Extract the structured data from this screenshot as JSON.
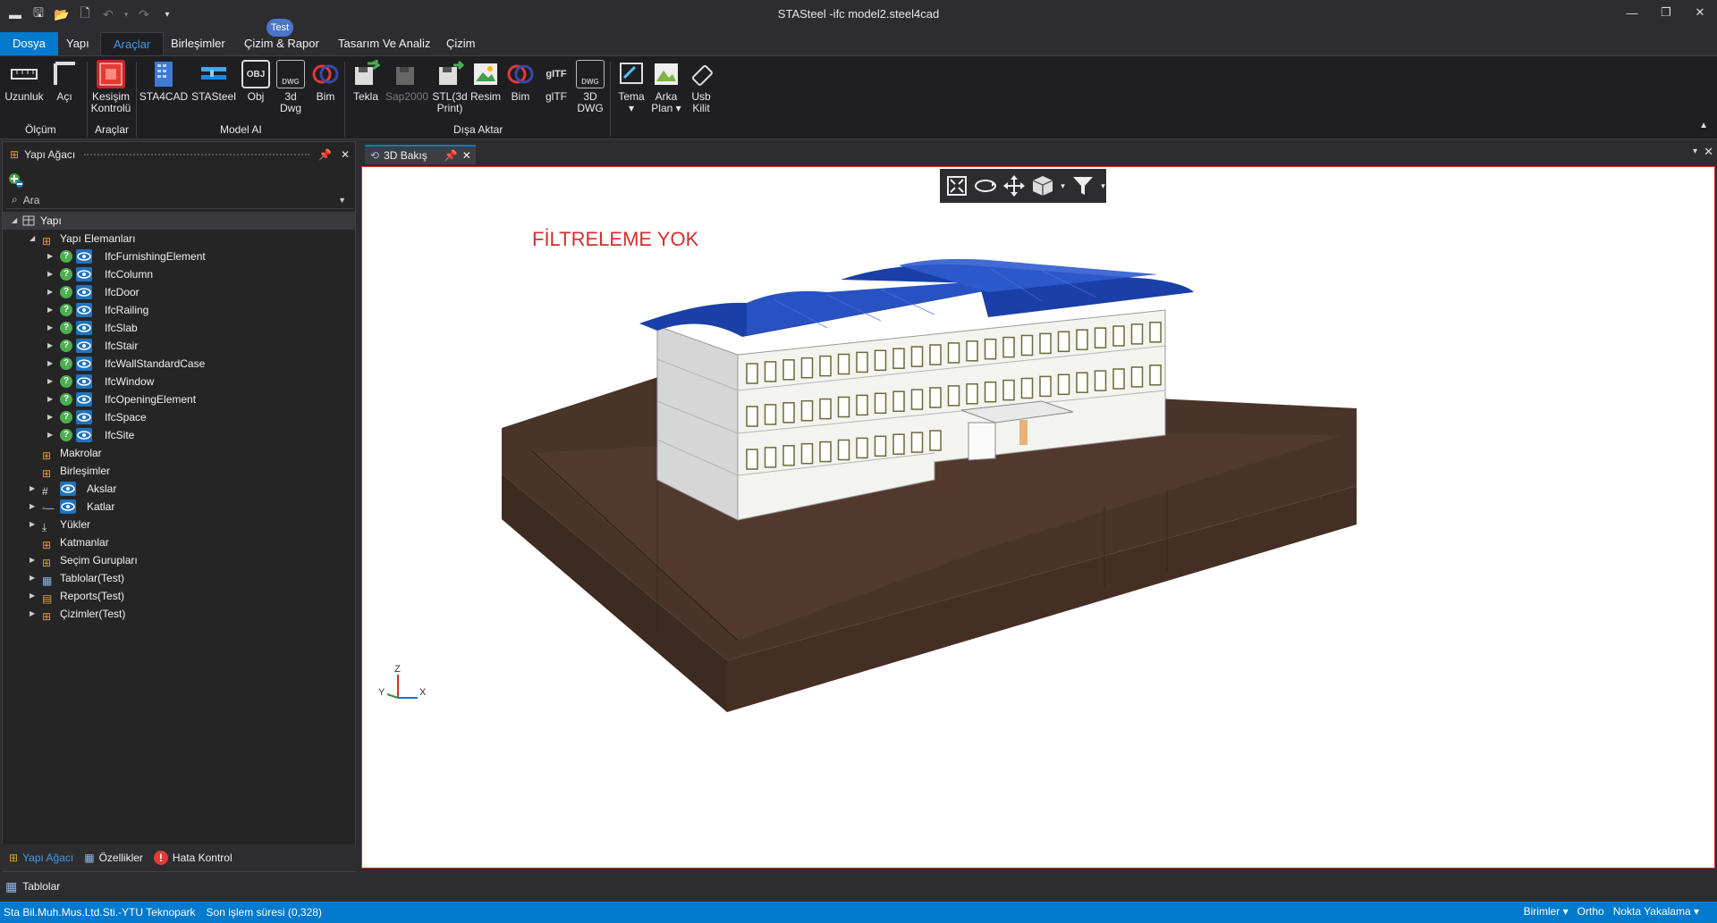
{
  "window": {
    "title": "STASteel -ifc model2.steel4cad"
  },
  "ribbon_tabs": [
    {
      "label": "Dosya"
    },
    {
      "label": "Yapı"
    },
    {
      "label": "Araçlar"
    },
    {
      "label": "Birleşimler"
    },
    {
      "label": "Çizim & Rapor"
    },
    {
      "label": "Tasarım Ve Analiz"
    },
    {
      "label": "Çizim"
    }
  ],
  "test_badge": "Test",
  "ribbon": {
    "buttons": {
      "uzunluk": "Uzunluk",
      "aci": "Açı",
      "kesisim": "Kesişim\nKontrolü",
      "sta4cad": "STA4CAD",
      "stasteel": "STASteel",
      "obj": "Obj",
      "dwg3d": "3d\nDwg",
      "bim1": "Bim",
      "tekla": "Tekla",
      "sap2000": "Sap2000",
      "stl": "STL(3d\nPrint)",
      "resim": "Resim",
      "bim2": "Bim",
      "gltf": "glTF",
      "dwg3dCaps": "3D\nDWG",
      "tema": "Tema",
      "arkaplan": "Arka\nPlan",
      "usb": "Usb\nKilit"
    },
    "icon_texts": {
      "obj": "OBJ",
      "dwg": "DWG",
      "gltf": "gITF"
    },
    "groups": {
      "olcum": "Ölçüm",
      "araclar": "Araçlar",
      "modelai": "Model AI",
      "disa": "Dışa Aktar"
    }
  },
  "left_panel": {
    "title": "Yapı Ağacı",
    "search_placeholder": "Ara",
    "tree": {
      "root": "Yapı",
      "elements": "Yapı Elemanları",
      "ifc": [
        "IfcFurnishingElement",
        "IfcColumn",
        "IfcDoor",
        "IfcRailing",
        "IfcSlab",
        "IfcStair",
        "IfcWallStandardCase",
        "IfcWindow",
        "IfcOpeningElement",
        "IfcSpace",
        "IfcSite"
      ],
      "makrolar": "Makrolar",
      "birlesimler": "Birleşimler",
      "akslar": "Akslar",
      "katlar": "Katlar",
      "yukler": "Yükler",
      "katmanlar": "Katmanlar",
      "secim": "Seçim Gurupları",
      "tablolar": "Tablolar(Test)",
      "reports": "Reports(Test)",
      "cizimler": "Çizimler(Test)"
    },
    "bottom_tabs": {
      "tree": "Yapı Ağacı",
      "props": "Özellikler",
      "errors": "Hata Kontrol"
    }
  },
  "document": {
    "tab": "3D Bakış",
    "label": "FİLTRELEME YOK",
    "axes": {
      "z": "Z",
      "y": "Y",
      "x": "X"
    }
  },
  "bottom_panel": {
    "tablolar": "Tablolar"
  },
  "status": {
    "company": "Sta Bil.Muh.Mus.Ltd.Sti.-YTU Teknopark",
    "last_op": "Son işlem süresi (0,328)",
    "units": "Birimler",
    "ortho": "Ortho",
    "snap": "Nokta Yakalama"
  },
  "colors": {
    "accent": "#007acc",
    "roof": "#1a3fa6",
    "ground": "#4a3429",
    "filter_label": "#d32f2f"
  }
}
